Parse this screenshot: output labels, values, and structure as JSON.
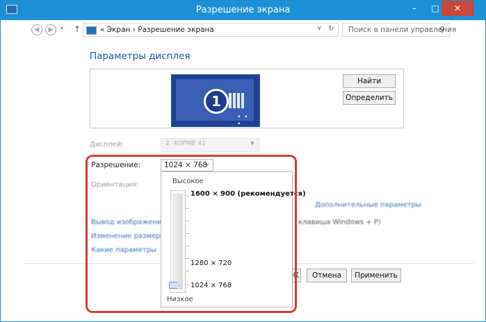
{
  "window": {
    "title": "Разрешение экрана",
    "controls": {
      "minimize": "–",
      "maximize": "□",
      "close": "✕"
    }
  },
  "nav": {
    "back_icon": "◀",
    "forward_icon": "▶",
    "dropdown_icon": "▾",
    "up_icon": "↑",
    "breadcrumb": "« Экран  ›  Разрешение экрана",
    "address_dropdown_icon": "∨",
    "refresh_icon": "↻",
    "search_placeholder": "Поиск в панели управления",
    "search_icon": "⚲"
  },
  "main": {
    "heading": "Параметры дисплея",
    "monitor_number": "1",
    "find_button": "Найти",
    "identify_button": "Определить",
    "display_label": "Дисплей:",
    "display_value": "2. ХОРМЕ 41",
    "resolution_label": "Разрешение:",
    "resolution_value": "1024 × 768",
    "orientation_label": "Ориентация:",
    "advanced_link": "Дополнительные параметры",
    "link1": "Вывод изображения на",
    "link2": "Изменение размеров",
    "link3": "Какие параметры",
    "windows_note": "клавиша Windows  + P)"
  },
  "dropdown": {
    "high_label": "Высокое",
    "low_label": "Низкое",
    "options": [
      "1600 × 900 (рекомендуется)",
      "1280 × 720",
      "1024 × 768"
    ],
    "selected": "1024 × 768"
  },
  "footer": {
    "ok_button": "ОК",
    "cancel_button": "Отмена",
    "apply_button": "Применить"
  },
  "colors": {
    "titlebar": "#1e90d6",
    "highlight": "#d73b3b",
    "heading": "#1d5aa3"
  }
}
